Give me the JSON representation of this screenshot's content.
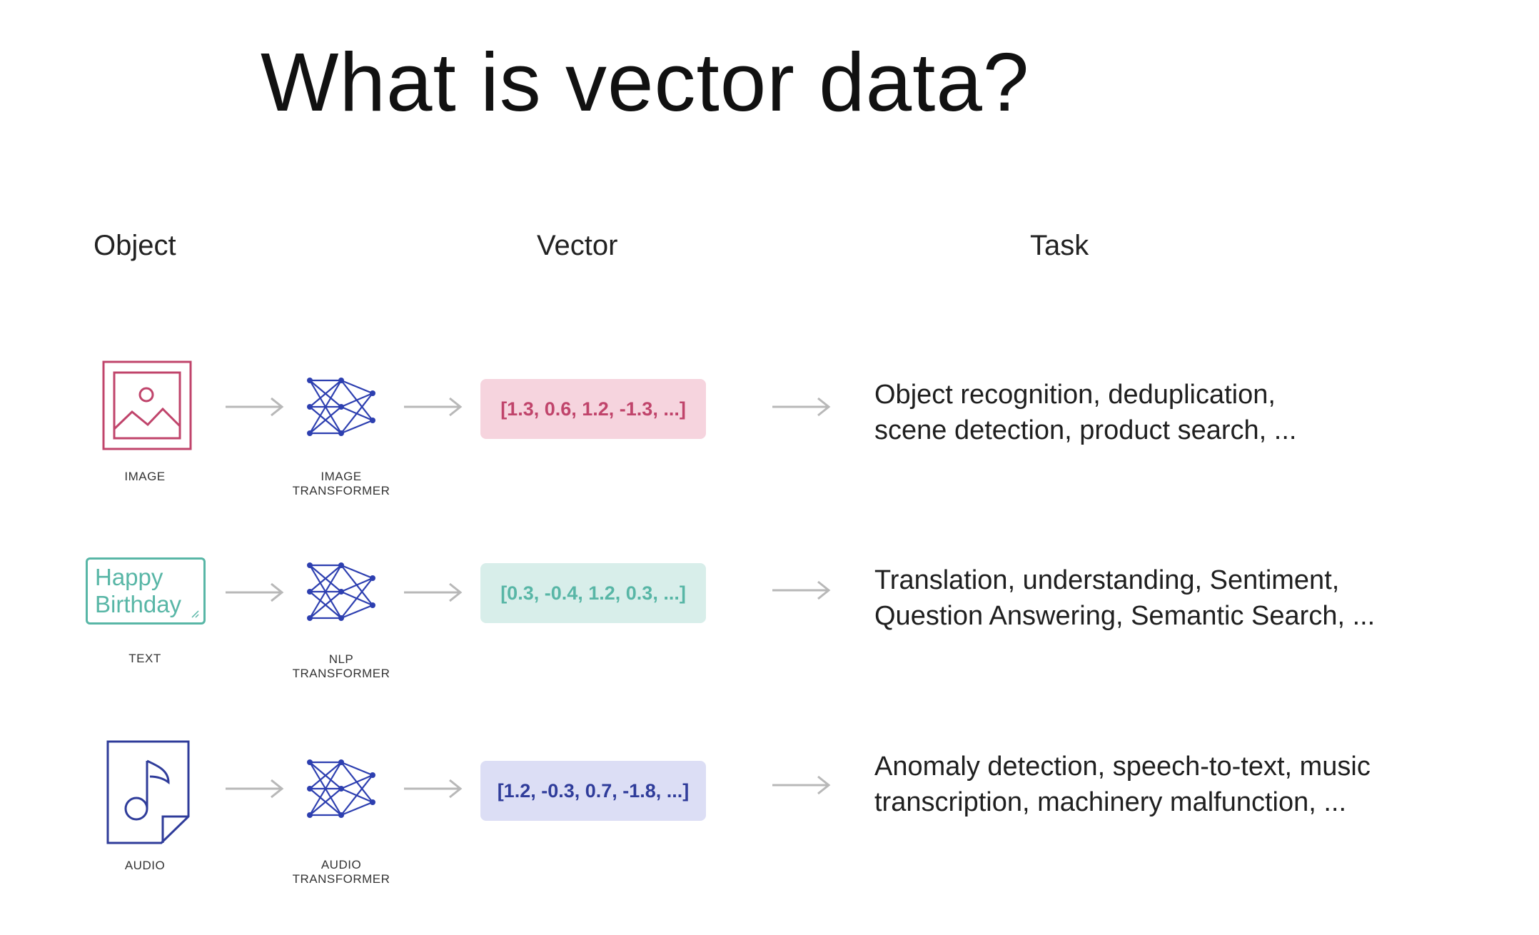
{
  "title": "What is vector data?",
  "headers": {
    "object": "Object",
    "vector": "Vector",
    "task": "Task"
  },
  "rows": [
    {
      "object_label": "IMAGE",
      "model_label": "IMAGE\nTRANSFORMER",
      "vector": "[1.3, 0.6, 1.2, -1.3, ...]",
      "task_line1": "Object recognition, deduplication,",
      "task_line2": "scene detection, product search, ..."
    },
    {
      "object_label": "TEXT",
      "object_text_line1": "Happy",
      "object_text_line2": "Birthday",
      "model_label": "NLP\nTRANSFORMER",
      "vector": "[0.3, -0.4, 1.2, 0.3, ...]",
      "task_line1": "Translation, understanding, Sentiment,",
      "task_line2": "Question Answering, Semantic Search, ..."
    },
    {
      "object_label": "AUDIO",
      "model_label": "AUDIO\nTRANSFORMER",
      "vector": "[1.2, -0.3, 0.7, -1.8, ...]",
      "task_line1": "Anomaly detection, speech-to-text, music",
      "task_line2": "transcription, machinery malfunction, ..."
    }
  ],
  "colors": {
    "image": "#c0446b",
    "image_bg": "#f6d4de",
    "text": "#58b6a6",
    "text_bg": "#d8eeea",
    "audio": "#2f3c9a",
    "audio_bg": "#dcdef5",
    "network": "#2d3fb0",
    "arrow": "#b8b8b8"
  },
  "icons": [
    "image-icon",
    "neural-network-icon",
    "arrow-right-icon",
    "music-file-icon"
  ]
}
